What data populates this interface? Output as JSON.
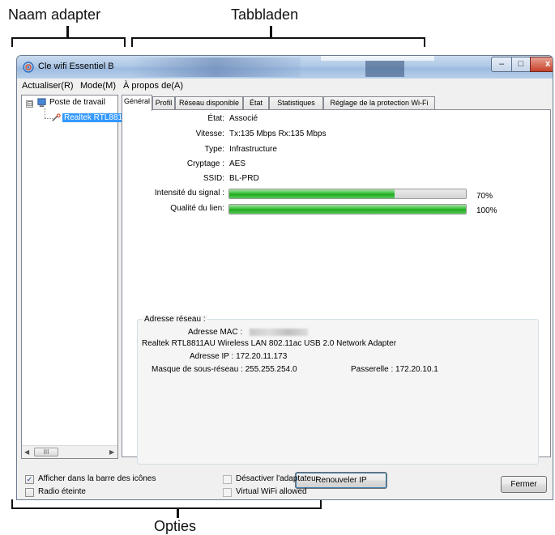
{
  "annotations": {
    "adapter_name": "Naam adapter",
    "tabs": "Tabbladen",
    "options": "Opties"
  },
  "window": {
    "title": "Cle wifi Essentiel B",
    "controls": {
      "minimize": "–",
      "maximize": "□",
      "close": "x"
    }
  },
  "menu": {
    "items": [
      "Actualiser(R)",
      "Mode(M)",
      "À propos de(A)"
    ]
  },
  "tree": {
    "root": "Poste de travail",
    "expander": "⊟",
    "child": "Realtek RTL881",
    "scroll_thumb": "III",
    "scroll_left": "◀",
    "scroll_right": "▶"
  },
  "tabs": [
    "Général",
    "Profil",
    "Réseau disponible",
    "État",
    "Statistiques",
    "Réglage de la protection Wi-Fi"
  ],
  "general": {
    "state_label": "État:",
    "state_value": "Associé",
    "speed_label": "Vitesse:",
    "speed_value": "Tx:135 Mbps Rx:135 Mbps",
    "type_label": "Type:",
    "type_value": "Infrastructure",
    "crypt_label": "Cryptage :",
    "crypt_value": "AES",
    "ssid_label": "SSID:",
    "ssid_value": "BL-PRD",
    "signal_label": "Intensité du signal :",
    "signal_value": 0.7,
    "signal_pct": "70%",
    "quality_label": "Qualité du lien:",
    "quality_value": 1.0,
    "quality_pct": "100%"
  },
  "network": {
    "title": "Adresse réseau :",
    "mac_label": "Adresse MAC :",
    "adapter_name": "Realtek RTL8811AU Wireless LAN 802.11ac USB 2.0 Network Adapter",
    "ip_label": "Adresse IP :",
    "ip_value": "172.20.11.173",
    "mask_label": "Masque de sous-réseau :",
    "mask_value": "255.255.254.0",
    "gateway_label": "Passerelle :",
    "gateway_value": "172.20.10.1"
  },
  "buttons": {
    "renew": "Renouveler IP",
    "close": "Fermer"
  },
  "options": {
    "show_tray": {
      "label": "Afficher dans la barre des icônes",
      "checked": "✓"
    },
    "radio_off": {
      "label": "Radio éteinte"
    },
    "disable_adapter": {
      "label": "Désactiver l'adaptateur"
    },
    "virtual_wifi": {
      "label": "Virtual WiFi allowed"
    }
  },
  "colors": {
    "progress_green": "#2fb52f",
    "selection_blue": "#3399ff",
    "close_red": "#c7412b"
  }
}
